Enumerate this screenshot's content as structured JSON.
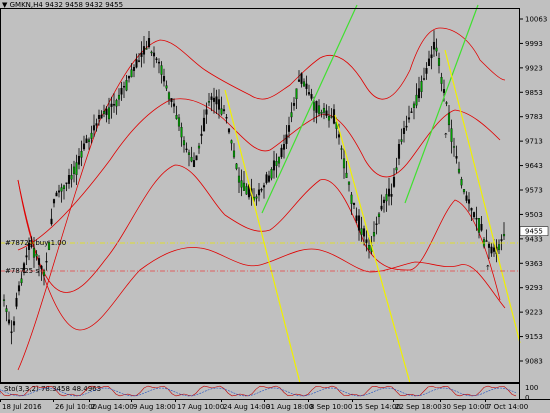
{
  "header": {
    "symbol_line": "GMKN,H4  9432 9458 9432 9455"
  },
  "price_axis": {
    "labels": [
      "10063",
      "9993",
      "9923",
      "9853",
      "9783",
      "9713",
      "9643",
      "9573",
      "9503",
      "9433",
      "9363",
      "9293",
      "9223",
      "9153",
      "9083"
    ],
    "current_price": "9455"
  },
  "time_axis": {
    "labels": [
      "18 Jul 2016",
      "26 Jul 10:00",
      "2 Aug 14:00",
      "9 Aug 18:00",
      "17 Aug 10:00",
      "24 Aug 14:00",
      "31 Aug 18:00",
      "8 Sep 10:00",
      "15 Sep 14:00",
      "22 Sep 18:00",
      "30 Sep 10:00",
      "7 Oct 14:00"
    ]
  },
  "order_lines": [
    {
      "label": "#78725 buy 1.00",
      "color": "#e8e800"
    },
    {
      "label": "#78725 s",
      "color": "#e84040"
    }
  ],
  "indicator": {
    "label": "Sto(3,3,2) 78.3458 48.4963",
    "labels": [
      "100",
      "0"
    ]
  },
  "colors": {
    "background": "#c0c0c0",
    "bull_candle": "#00a000",
    "bear_candle": "#000000",
    "bands": "#e00000",
    "trend_green": "#40e030",
    "trend_yellow": "#f0f000"
  }
}
